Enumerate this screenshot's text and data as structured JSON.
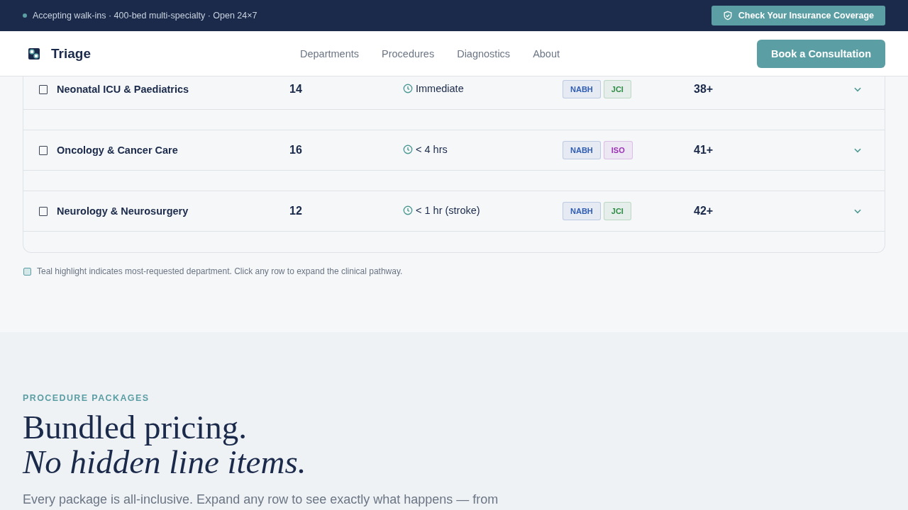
{
  "topbar": {
    "status": "Accepting walk-ins · 400-bed multi-specialty · Open 24×7",
    "button": "Check Your Insurance Coverage"
  },
  "nav": {
    "brand": "Triage",
    "links": [
      "Departments",
      "Procedures",
      "Diagnostics",
      "About"
    ],
    "cta": "Book a Consultation"
  },
  "table": {
    "rows": [
      {
        "name": "Neonatal ICU & Paediatrics",
        "checked": false,
        "count": "14",
        "time": "Immediate",
        "tags": [
          {
            "label": "NABH",
            "color": "#2f5cb3"
          },
          {
            "label": "JCI",
            "color": "#2e8b45"
          }
        ],
        "value": "38+",
        "expanded": false
      },
      {
        "name": "Oncology & Cancer Care",
        "checked": false,
        "count": "16",
        "time": "< 4 hrs",
        "tags": [
          {
            "label": "NABH",
            "color": "#2f5cb3"
          },
          {
            "label": "ISO",
            "color": "#9a32b3"
          }
        ],
        "value": "41+",
        "expanded": false
      },
      {
        "name": "Neurology & Neurosurgery",
        "checked": false,
        "count": "12",
        "time": "< 1 hr (stroke)",
        "tags": [
          {
            "label": "NABH",
            "color": "#2f5cb3"
          },
          {
            "label": "JCI",
            "color": "#2e8b45"
          }
        ],
        "value": "42+",
        "expanded": false
      }
    ],
    "legend": "Teal highlight indicates most-requested department. Click any row to expand the clinical pathway."
  },
  "packages": {
    "eyebrow": "PROCEDURE PACKAGES",
    "title": "Bundled pricing.",
    "title_italic": "No hidden line items.",
    "intro": "Every package is all-inclusive. Expand any row to see exactly what happens — from"
  }
}
